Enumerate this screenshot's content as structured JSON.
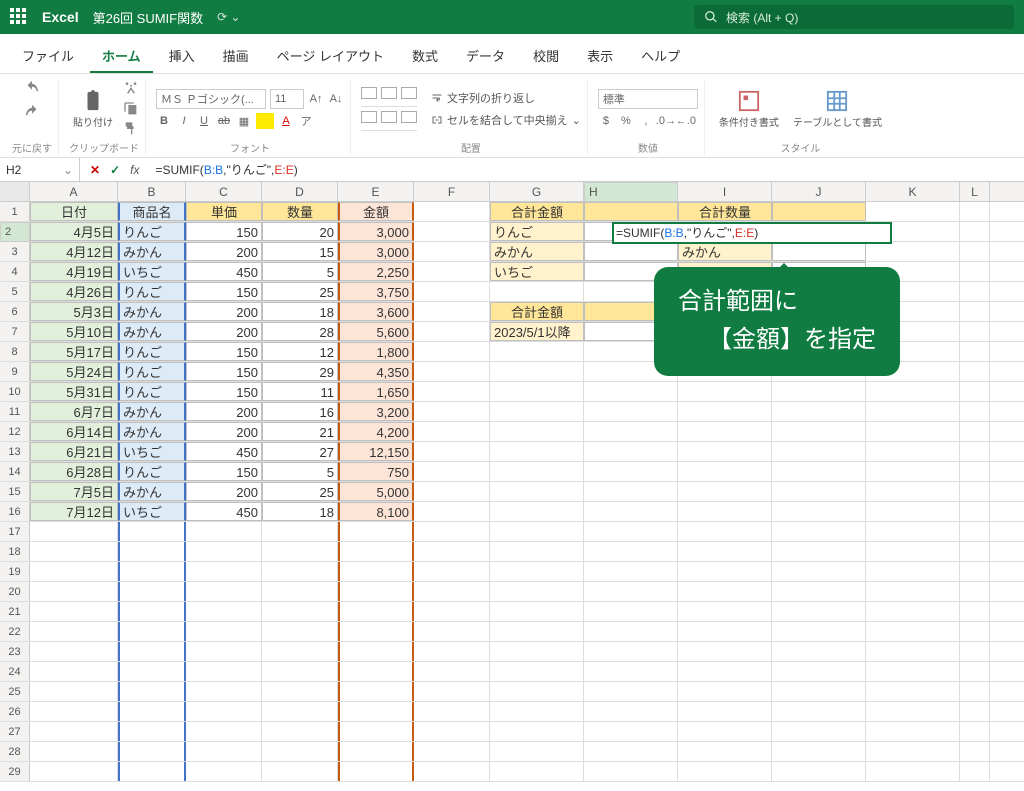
{
  "title": {
    "app": "Excel",
    "doc": "第26回 SUMIF関数",
    "search_ph": "検索 (Alt + Q)"
  },
  "tabs": [
    "ファイル",
    "ホーム",
    "挿入",
    "描画",
    "ページ レイアウト",
    "数式",
    "データ",
    "校閲",
    "表示",
    "ヘルプ"
  ],
  "active_tab": 1,
  "ribbon": {
    "undo": "元に戻す",
    "clipboard": "クリップボード",
    "paste": "貼り付け",
    "font": "フォント",
    "font_name": "ＭＳ Ｐゴシック(...",
    "font_size": "11",
    "align": "配置",
    "wrap": "文字列の折り返し",
    "merge": "セルを結合して中央揃え",
    "number": "数値",
    "num_fmt": "標準",
    "styles": "スタイル",
    "cond_fmt": "条件付き書式",
    "table_fmt": "テーブルとして書式"
  },
  "namebox": "H2",
  "formula": {
    "pre": "=SUMIF(",
    "r1": "B:B",
    "mid": ",\"りんご\",",
    "r2": "E:E",
    "post": ")"
  },
  "cols": [
    "A",
    "B",
    "C",
    "D",
    "E",
    "F",
    "G",
    "H",
    "I",
    "J",
    "K",
    "L"
  ],
  "headers1": {
    "date": "日付",
    "item": "商品名",
    "price": "単価",
    "qty": "数量",
    "amount": "金額"
  },
  "table1": [
    [
      "4月5日",
      "りんご",
      "150",
      "20",
      "3,000"
    ],
    [
      "4月12日",
      "みかん",
      "200",
      "15",
      "3,000"
    ],
    [
      "4月19日",
      "いちご",
      "450",
      "5",
      "2,250"
    ],
    [
      "4月26日",
      "りんご",
      "150",
      "25",
      "3,750"
    ],
    [
      "5月3日",
      "みかん",
      "200",
      "18",
      "3,600"
    ],
    [
      "5月10日",
      "みかん",
      "200",
      "28",
      "5,600"
    ],
    [
      "5月17日",
      "りんご",
      "150",
      "12",
      "1,800"
    ],
    [
      "5月24日",
      "りんご",
      "150",
      "29",
      "4,350"
    ],
    [
      "5月31日",
      "りんご",
      "150",
      "11",
      "1,650"
    ],
    [
      "6月7日",
      "みかん",
      "200",
      "16",
      "3,200"
    ],
    [
      "6月14日",
      "みかん",
      "200",
      "21",
      "4,200"
    ],
    [
      "6月21日",
      "いちご",
      "450",
      "27",
      "12,150"
    ],
    [
      "6月28日",
      "りんご",
      "150",
      "5",
      "750"
    ],
    [
      "7月5日",
      "みかん",
      "200",
      "25",
      "5,000"
    ],
    [
      "7月12日",
      "いちご",
      "450",
      "18",
      "8,100"
    ]
  ],
  "sum1": {
    "hdr_amt": "合計金額",
    "hdr_qty": "合計数量",
    "items": [
      "りんご",
      "みかん",
      "いちご"
    ],
    "right": [
      "",
      "みかん",
      ""
    ]
  },
  "sum2": {
    "hdr": "合計金額",
    "row": "2023/5/1以降"
  },
  "edit": {
    "pre": "=SUMIF(",
    "r1": "B:B",
    "mid": ",\"りんご\",",
    "r2": "E:E",
    "post": ")"
  },
  "callout": {
    "l1": "合計範囲に",
    "l2": "【金額】を指定"
  }
}
